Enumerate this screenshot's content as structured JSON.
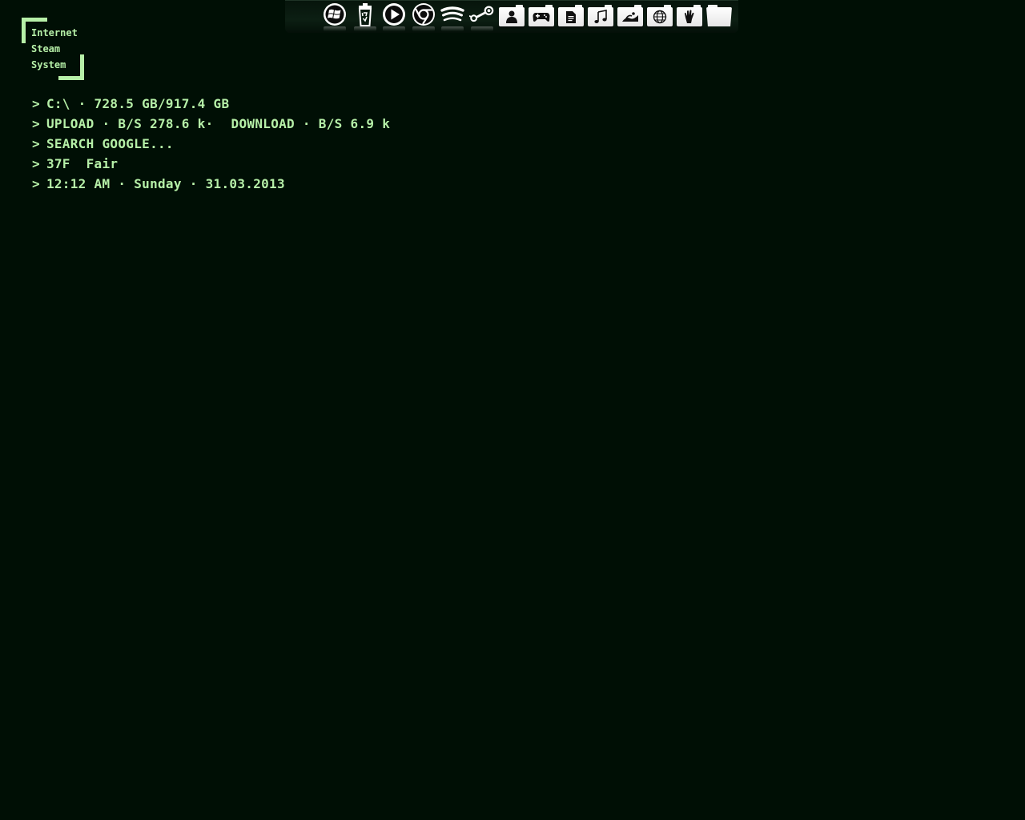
{
  "launcher": {
    "items": [
      {
        "label": "Internet"
      },
      {
        "label": "Steam"
      },
      {
        "label": "System"
      }
    ]
  },
  "console": {
    "prompt": ">",
    "disk": "C:\\ · 728.5 GB/917.4 GB",
    "network_upload": "UPLOAD · B/S 278.6 k·",
    "network_download": "DOWNLOAD · B/S 6.9 k",
    "search": "SEARCH GOOGLE...",
    "weather_temp": "37F",
    "weather_condition": "Fair",
    "datetime": "12:12 AM · Sunday · 31.03.2013"
  },
  "dock": {
    "icons": [
      {
        "name": "windows-start-icon"
      },
      {
        "name": "recycle-bin-icon"
      },
      {
        "name": "media-player-icon"
      },
      {
        "name": "chrome-icon"
      },
      {
        "name": "spotify-icon"
      },
      {
        "name": "steam-icon"
      },
      {
        "name": "user-folder-icon"
      },
      {
        "name": "games-folder-icon"
      },
      {
        "name": "documents-folder-icon"
      },
      {
        "name": "music-folder-icon"
      },
      {
        "name": "pictures-folder-icon"
      },
      {
        "name": "network-folder-icon"
      },
      {
        "name": "shared-folder-icon"
      },
      {
        "name": "folder-icon"
      }
    ]
  },
  "colors": {
    "background": "#000f05",
    "text": "#b6f0a8",
    "dock_icon": "#ffffff"
  }
}
